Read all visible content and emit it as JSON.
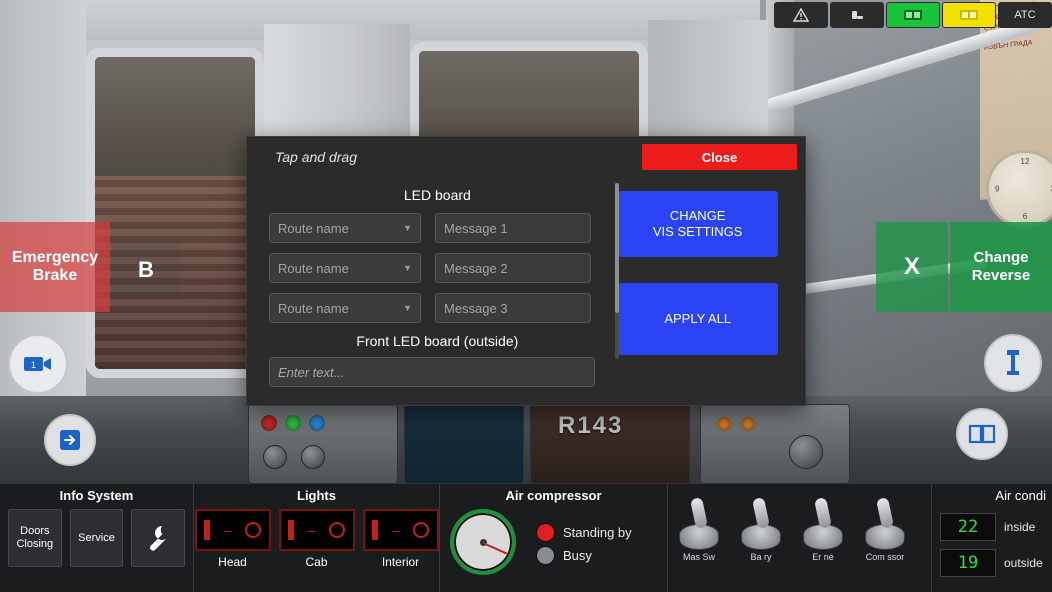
{
  "topbar": {
    "cells": [
      {
        "icon": "warning-triangle-icon",
        "label": "",
        "style": "dark"
      },
      {
        "icon": "seat-icon",
        "label": "",
        "style": "dark"
      },
      {
        "icon": "door-green-icon",
        "label": "",
        "style": "green"
      },
      {
        "icon": "door-yellow-icon",
        "label": "",
        "style": "yellow"
      },
      {
        "icon": "",
        "label": "ATC",
        "style": "dark"
      }
    ]
  },
  "hud": {
    "emergency_brake": "Emergency\nBrake",
    "emergency_brake_line1": "Emergency",
    "emergency_brake_line2": "Brake",
    "brake_letter": "B",
    "change_x": "X",
    "change_reverse_line1": "Change",
    "change_reverse_line2": "Reverse",
    "camera_icon": "camera-icon",
    "door_icon": "door-enter-icon",
    "info_icon": "info-icon",
    "book_icon": "book-icon"
  },
  "scene": {
    "loco_id": "R143",
    "advert_text": "ЗА ПРЕВОЗ НА ТОВАРИ СПРЕД СТРОГ УДОБНО ЗА ПРЕВОЗ ИЗВЪН ГРАДА"
  },
  "modal": {
    "drag_hint": "Tap and drag",
    "close_label": "Close",
    "led_board_title": "LED board",
    "rows": [
      {
        "route_placeholder": "Route name",
        "message_placeholder": "Message 1"
      },
      {
        "route_placeholder": "Route name",
        "message_placeholder": "Message 2"
      },
      {
        "route_placeholder": "Route name",
        "message_placeholder": "Message 3"
      }
    ],
    "front_led_title": "Front LED board (outside)",
    "front_led_placeholder": "Enter text...",
    "change_vis_line1": "CHANGE",
    "change_vis_line2": "VIS SETTINGS",
    "apply_all": "APPLY ALL",
    "accent_red": "#ec1c1c",
    "accent_blue": "#2a43f5"
  },
  "bottom": {
    "info_system": {
      "title": "Info System",
      "doors_line1": "Doors",
      "doors_line2": "Closing",
      "service": "Service",
      "wrench_icon": "wrench-icon"
    },
    "lights": {
      "title": "Lights",
      "items": [
        {
          "label": "Head"
        },
        {
          "label": "Cab"
        },
        {
          "label": "Interior"
        }
      ]
    },
    "air_compressor": {
      "title": "Air compressor",
      "states": [
        {
          "label": "Standing by",
          "on": true
        },
        {
          "label": "Busy",
          "on": false
        }
      ]
    },
    "switches": [
      {
        "label": "Mas  Sw"
      },
      {
        "label": "Ba   ry"
      },
      {
        "label": "Er   ne"
      },
      {
        "label": "Com   ssor"
      }
    ],
    "air_conditioning": {
      "title": "Air condi",
      "inside_value": "22",
      "inside_label": "inside",
      "outside_value": "19",
      "outside_label": "outside"
    }
  }
}
